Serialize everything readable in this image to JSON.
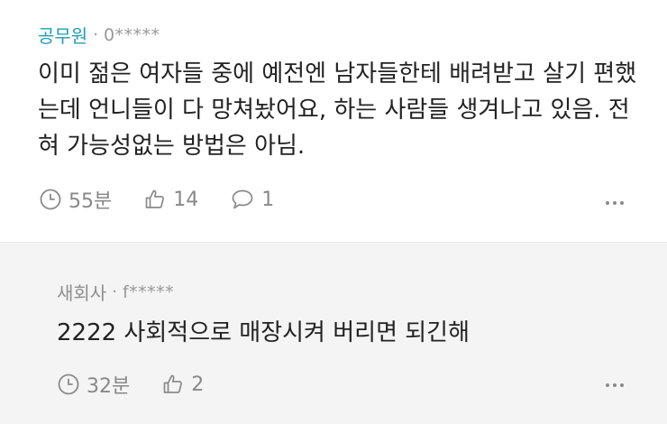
{
  "comments": [
    {
      "author": "공무원",
      "separator": "·",
      "username": "0*****",
      "body": "이미 젊은 여자들 중에 예전엔 남자들한테 배려받고 살기 편했는데 언니들이 다 망쳐놨어요, 하는 사람들 생겨나고 있음. 전혀 가능성없는 방법은 아님.",
      "time": "55분",
      "likes": "14",
      "replies": "1"
    },
    {
      "author": "새회사",
      "separator": "·",
      "username": "f*****",
      "body": "2222 사회적으로 매장시켜 버리면 되긴해",
      "time": "32분",
      "likes": "2"
    }
  ],
  "icons": {
    "clock": "clock-icon",
    "like": "thumbs-up-icon",
    "reply": "speech-bubble-icon",
    "more": "more-dots-icon"
  },
  "colors": {
    "author_accent": "#1e9fb0",
    "muted": "#888888",
    "reply_background": "#f4f4f4"
  }
}
